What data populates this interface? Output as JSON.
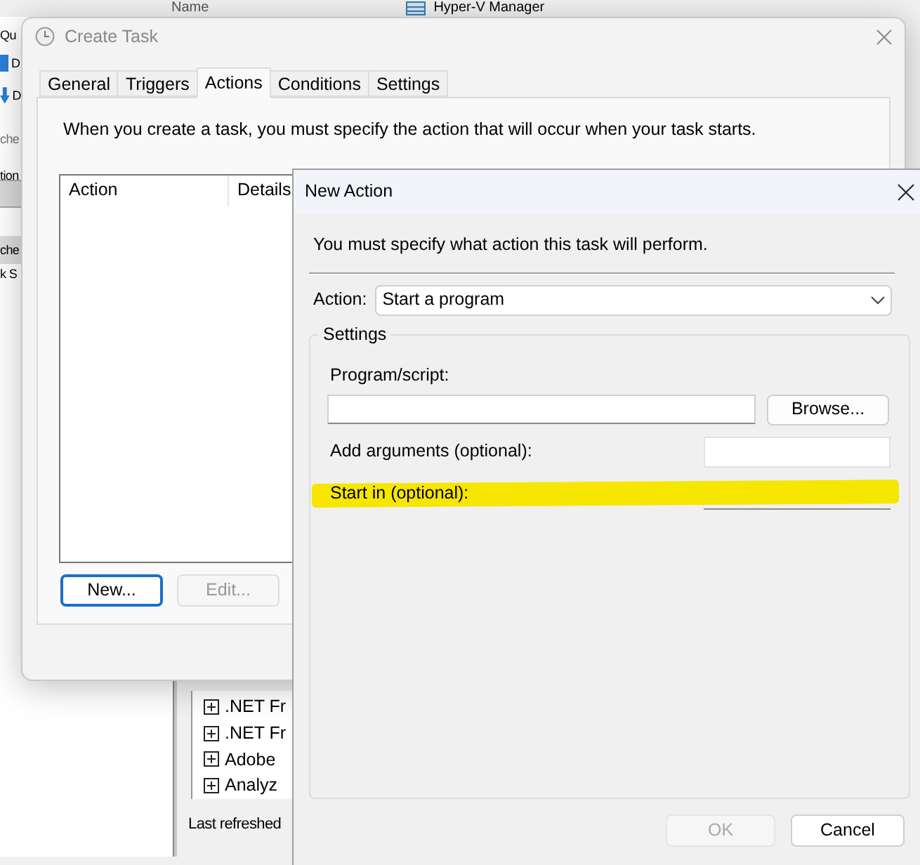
{
  "background": {
    "left_pane": [
      {
        "text": "Qu",
        "kind": "menu"
      },
      {
        "text": "D",
        "kind": "doc"
      },
      {
        "text": "D",
        "kind": "download"
      },
      {
        "text": "che",
        "kind": "search"
      },
      {
        "text": "tion",
        "kind": "header"
      },
      {
        "text": "che",
        "kind": "selected"
      },
      {
        "text": "k S",
        "kind": "item"
      }
    ],
    "column_header": "Name",
    "top_item": "Hyper-V Manager",
    "tree": [
      {
        "label": ".NET Fr",
        "expanded": false
      },
      {
        "label": ".NET Fr",
        "expanded": false
      },
      {
        "label": "Adobe",
        "expanded": false
      },
      {
        "label": "Analyz",
        "expanded": false
      }
    ],
    "status": "Last refreshed"
  },
  "create_task": {
    "title": "Create Task",
    "tabs": [
      {
        "label": "General",
        "selected": false
      },
      {
        "label": "Triggers",
        "selected": false
      },
      {
        "label": "Actions",
        "selected": true
      },
      {
        "label": "Conditions",
        "selected": false
      },
      {
        "label": "Settings",
        "selected": false
      }
    ],
    "intro": "When you create a task, you must specify the action that will occur when your task starts.",
    "list_columns": [
      "Action",
      "Details"
    ],
    "buttons": [
      {
        "label": "New...",
        "focused": true,
        "disabled": false
      },
      {
        "label": "Edit...",
        "focused": false,
        "disabled": true
      }
    ]
  },
  "new_action": {
    "title": "New Action",
    "intro": "You must specify what action this task will perform.",
    "action_label": "Action:",
    "action_value": "Start a program",
    "group_label": "Settings",
    "fields": [
      {
        "label": "Program/script:",
        "kind": "wide",
        "highlighted": false
      },
      {
        "label": "Add arguments (optional):",
        "kind": "inline",
        "highlighted": false
      },
      {
        "label": "Start in (optional):",
        "kind": "inline",
        "highlighted": true
      }
    ],
    "browse": "Browse...",
    "buttons": [
      {
        "label": "OK",
        "disabled": true
      },
      {
        "label": "Cancel",
        "disabled": false
      }
    ]
  }
}
